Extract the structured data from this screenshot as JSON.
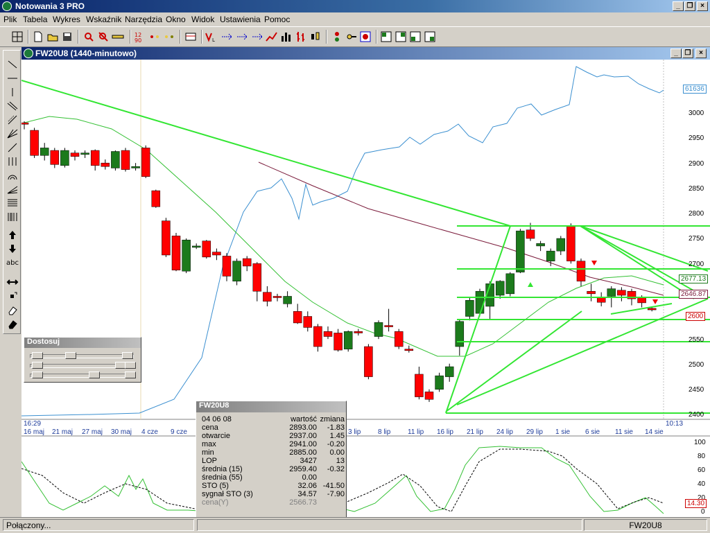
{
  "app": {
    "title": "Notowania 3 PRO"
  },
  "menu": [
    "Plik",
    "Tabela",
    "Wykres",
    "Wskaźnik",
    "Narzędzia",
    "Okno",
    "Widok",
    "Ustawienia",
    "Pomoc"
  ],
  "doc": {
    "title": "FW20U8 (1440-minutowo)"
  },
  "palette": {
    "text_tool": "abc"
  },
  "dostosuj": {
    "title": "Dostosuj"
  },
  "axis": {
    "price_labels": [
      "3000",
      "2950",
      "2900",
      "2850",
      "2800",
      "2750",
      "2700",
      "2650",
      "2600",
      "2550",
      "2500",
      "2450",
      "2400"
    ],
    "x_labels": [
      "16 maj",
      "21 maj",
      "27 maj",
      "30 maj",
      "4 cze",
      "9 cze",
      "3 lip",
      "8 lip",
      "11 lip",
      "16 lip",
      "21 lip",
      "24 lip",
      "29 lip",
      "1 sie",
      "6 sie",
      "11 sie",
      "14 sie"
    ],
    "time_left": "16:29",
    "time_right": "10:13",
    "osc_labels": [
      "100",
      "80",
      "60",
      "40",
      "20",
      "0"
    ],
    "lop_value": "61636",
    "box_values": [
      "2677.13",
      "2646.87",
      "2600"
    ],
    "sto_value": "14.30"
  },
  "info": {
    "title": "FW20U8",
    "date": "04 06 08",
    "col1": "wartość",
    "col2": "zmiana",
    "rows": [
      {
        "name": "cena",
        "value": "2893.00",
        "change": "-1.83"
      },
      {
        "name": "otwarcie",
        "value": "2937.00",
        "change": "1.45"
      },
      {
        "name": "max",
        "value": "2941.00",
        "change": "-0.20"
      },
      {
        "name": "min",
        "value": "2885.00",
        "change": "0.00"
      },
      {
        "name": "LOP",
        "value": "3427",
        "change": "13"
      },
      {
        "name": "średnia (15)",
        "value": "2959.40",
        "change": "-0.32"
      },
      {
        "name": "średnia (55)",
        "value": "0.00",
        "change": ""
      },
      {
        "name": "STO (5)",
        "value": "32.06",
        "change": "-41.50"
      },
      {
        "name": "sygnał STO (3)",
        "value": "34.57",
        "change": "-7.90"
      },
      {
        "name": "cena(Y)",
        "value": "2566.73",
        "change": ""
      }
    ]
  },
  "status": {
    "left": "Połączony...",
    "right": "FW20U8"
  },
  "colors": {
    "up": "#1c7a1c",
    "down": "#ff0000",
    "trend": "#33e633",
    "lop": "#3a8fd0",
    "ma15": "#33c033",
    "ma55": "#7a1a3a"
  }
}
